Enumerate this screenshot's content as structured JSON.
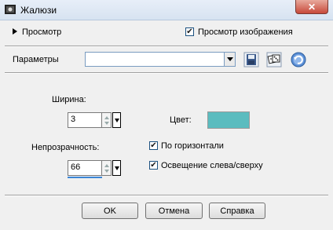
{
  "window": {
    "title": "Жалюзи",
    "close_label": "✕"
  },
  "preview": {
    "section_label": "Просмотр",
    "show_preview_label": "Просмотр изображения",
    "show_preview_checked": true
  },
  "presets": {
    "label": "Параметры",
    "value": ""
  },
  "settings": {
    "width_label": "Ширина:",
    "width_value": "3",
    "opacity_label": "Непрозрачность:",
    "opacity_value": "66",
    "color_label": "Цвет:",
    "color_value": "#5bbcbf",
    "horizontal_label": "По горизонтали",
    "horizontal_checked": true,
    "light_label": "Освещение слева/сверху",
    "light_checked": true
  },
  "buttons": {
    "ok": "OK",
    "cancel": "Отмена",
    "help": "Справка"
  }
}
